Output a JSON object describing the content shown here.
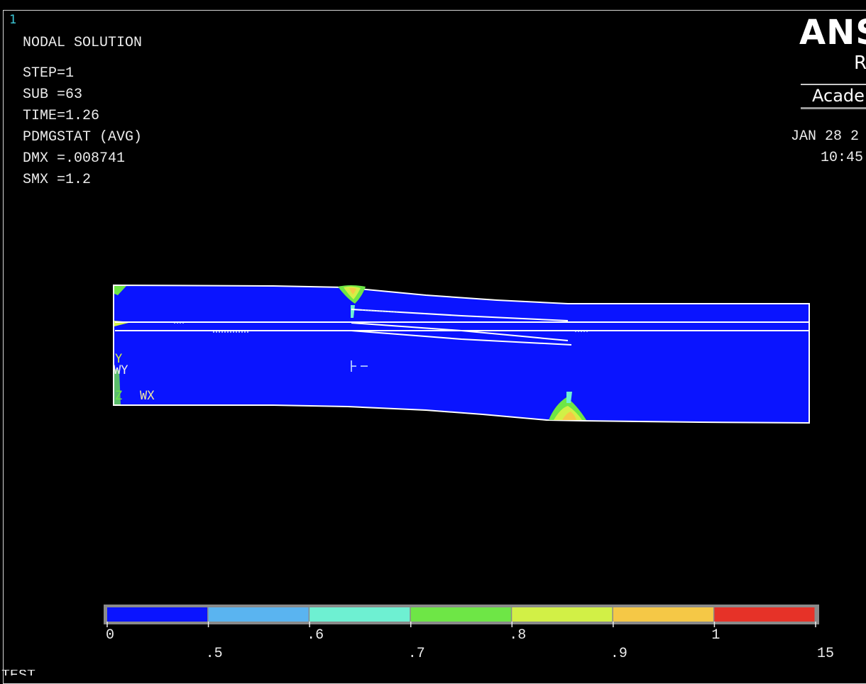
{
  "window": {
    "number": "1"
  },
  "header": {
    "title": "NODAL SOLUTION",
    "step": "STEP=1",
    "sub": "SUB =63",
    "time": "TIME=1.26",
    "result_item": "PDMGSTAT (AVG)",
    "dmx": "DMX =.008741",
    "smx": "SMX =1.2"
  },
  "branding": {
    "name": "ANS",
    "release": "R",
    "edition": "Acade",
    "date": "JAN 28 2",
    "time": "10:45"
  },
  "triad": {
    "y": "Y",
    "wy": "WY",
    "z": "Z",
    "wx": "WX"
  },
  "legend": {
    "colors": [
      "#0a14ff",
      "#5ab4f0",
      "#6ef0d2",
      "#6ee646",
      "#d2f046",
      "#f5c846",
      "#e63228"
    ],
    "labels": [
      "0",
      ".5",
      ".6",
      ".7",
      ".8",
      ".9",
      "1",
      "15"
    ]
  },
  "footer": {
    "partial_text": "TEST"
  }
}
